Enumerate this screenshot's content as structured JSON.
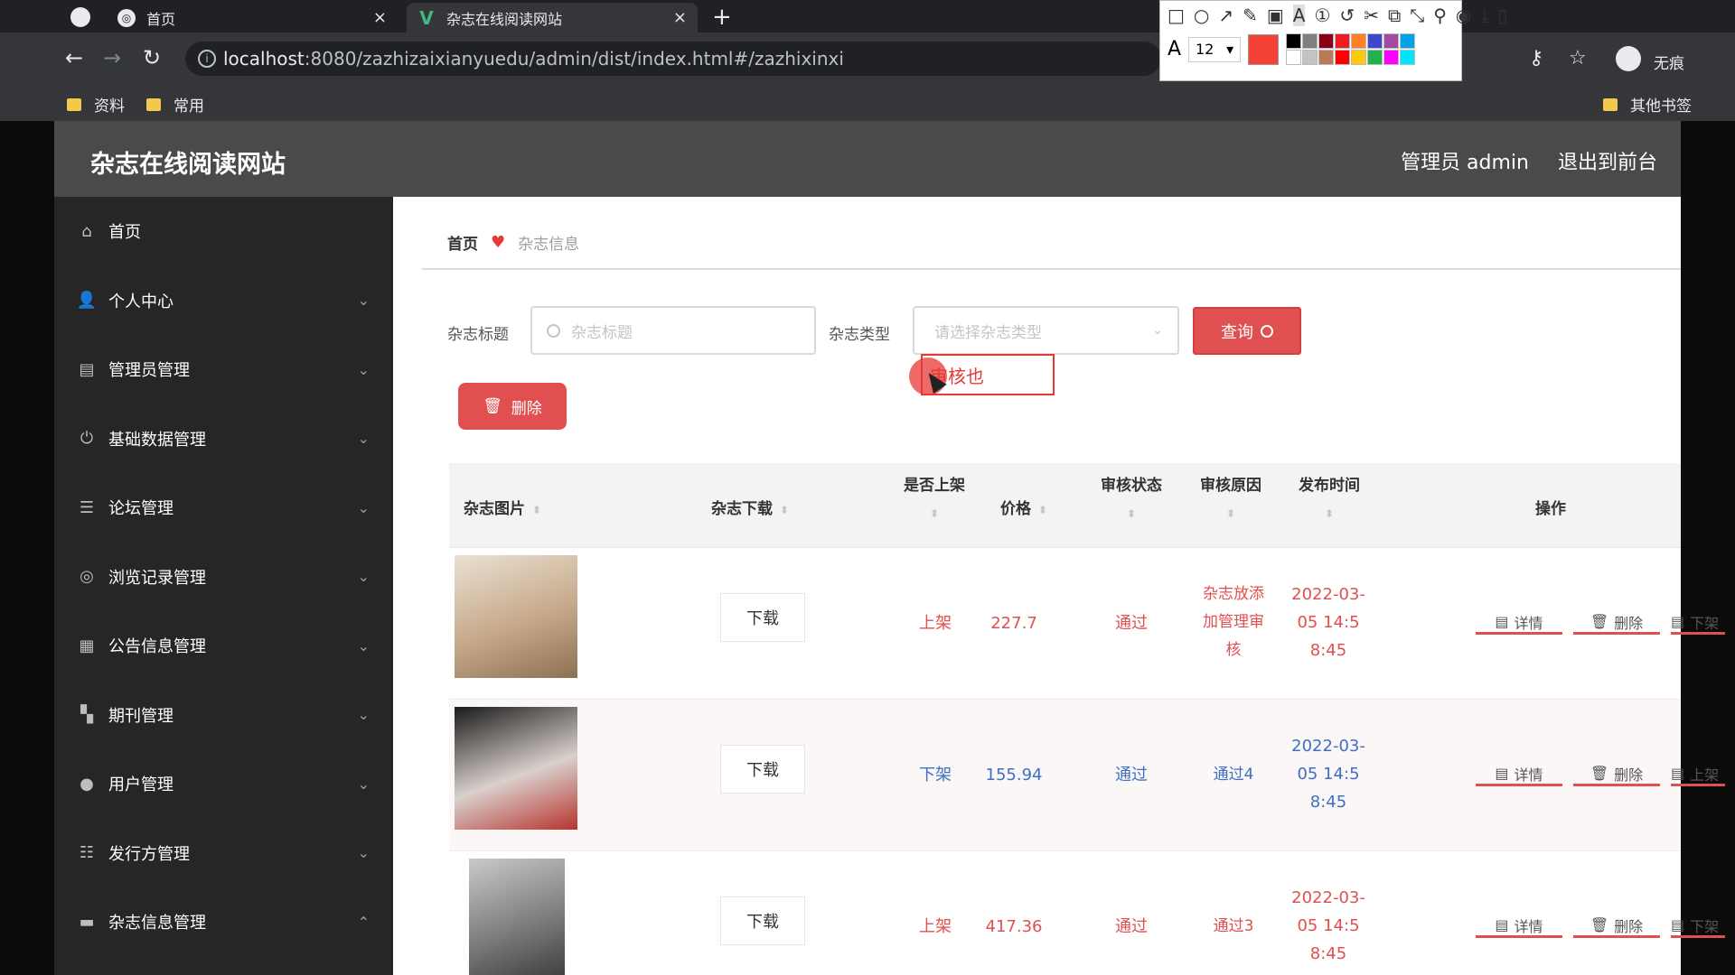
{
  "browser": {
    "tabs": [
      {
        "label": "首页",
        "close": "×"
      },
      {
        "label": "杂志在线阅读网站",
        "close": "×"
      }
    ],
    "new_tab": "+",
    "url_host": "localhost",
    "url_path": ":8080/zazhizaixianyuedu/admin/dist/index.html#/zazhixinxi",
    "bookmarks": [
      "资料",
      "常用"
    ],
    "other_bookmarks": "其他书签",
    "profile_label": "无痕"
  },
  "annotation_toolbar": {
    "font_label": "A",
    "font_size": "12",
    "palette": [
      "#000000",
      "#7f7f7f",
      "#880015",
      "#ed1c24",
      "#ff7f27",
      "#3f48cc",
      "#a349a4",
      "#00a2e8",
      "#ffffff",
      "#c3c3c3",
      "#b97a57",
      "#ff0000",
      "#ffc90e",
      "#22b14c",
      "#ff00ff",
      "#00e5ff"
    ],
    "current_color": "#f44336"
  },
  "app": {
    "title": "杂志在线阅读网站",
    "admin_label": "管理员 admin",
    "logout_label": "退出到前台",
    "sidebar": [
      {
        "label": "首页",
        "icon": "home-icon",
        "glyph": "⌂",
        "chevron": ""
      },
      {
        "label": "个人中心",
        "icon": "user-icon",
        "glyph": "👤",
        "chevron": "⌄"
      },
      {
        "label": "管理员管理",
        "icon": "id-card-icon",
        "glyph": "▤",
        "chevron": "⌄"
      },
      {
        "label": "基础数据管理",
        "icon": "power-icon",
        "glyph": "⏻",
        "chevron": "⌄"
      },
      {
        "label": "论坛管理",
        "icon": "list-icon",
        "glyph": "☰",
        "chevron": "⌄"
      },
      {
        "label": "浏览记录管理",
        "icon": "target-icon",
        "glyph": "◎",
        "chevron": "⌄"
      },
      {
        "label": "公告信息管理",
        "icon": "grid-icon",
        "glyph": "▦",
        "chevron": "⌄"
      },
      {
        "label": "期刊管理",
        "icon": "apps-icon",
        "glyph": "▚",
        "chevron": "⌄"
      },
      {
        "label": "用户管理",
        "icon": "location-icon",
        "glyph": "●",
        "chevron": "⌄"
      },
      {
        "label": "发行方管理",
        "icon": "sliders-icon",
        "glyph": "☷",
        "chevron": "⌄"
      },
      {
        "label": "杂志信息管理",
        "icon": "printer-icon",
        "glyph": "▬",
        "chevron": "⌃"
      }
    ],
    "breadcrumb": {
      "home": "首页",
      "current": "杂志信息"
    },
    "search": {
      "title_label": "杂志标题",
      "title_placeholder": "杂志标题",
      "type_label": "杂志类型",
      "type_placeholder": "请选择杂志类型",
      "query_button": "查询"
    },
    "delete_button": "删除",
    "annotation_text": "审核也",
    "table": {
      "headers": {
        "image": "杂志图片",
        "download": "杂志下载",
        "shelf": "是否上架",
        "price": "价格",
        "review_status": "审核状态",
        "review_reason": "审核原因",
        "publish_time": "发布时间",
        "ops": "操作"
      },
      "rows": [
        {
          "download": "下载",
          "shelf": "上架",
          "price": "227.7",
          "status": "通过",
          "reason": "杂志放添加管理审核",
          "time": "2022-03-05 14:58:45",
          "detail": "详情",
          "delete": "删除",
          "toggle": "下架",
          "color": "red"
        },
        {
          "download": "下载",
          "shelf": "下架",
          "price": "155.94",
          "status": "通过",
          "reason": "通过4",
          "time": "2022-03-05 14:58:45",
          "detail": "详情",
          "delete": "删除",
          "toggle": "上架",
          "color": "blue"
        },
        {
          "download": "下载",
          "shelf": "上架",
          "price": "417.36",
          "status": "通过",
          "reason": "通过3",
          "time": "2022-03-05 14:58:45",
          "detail": "详情",
          "delete": "删除",
          "toggle": "下架",
          "color": "red"
        }
      ]
    }
  }
}
